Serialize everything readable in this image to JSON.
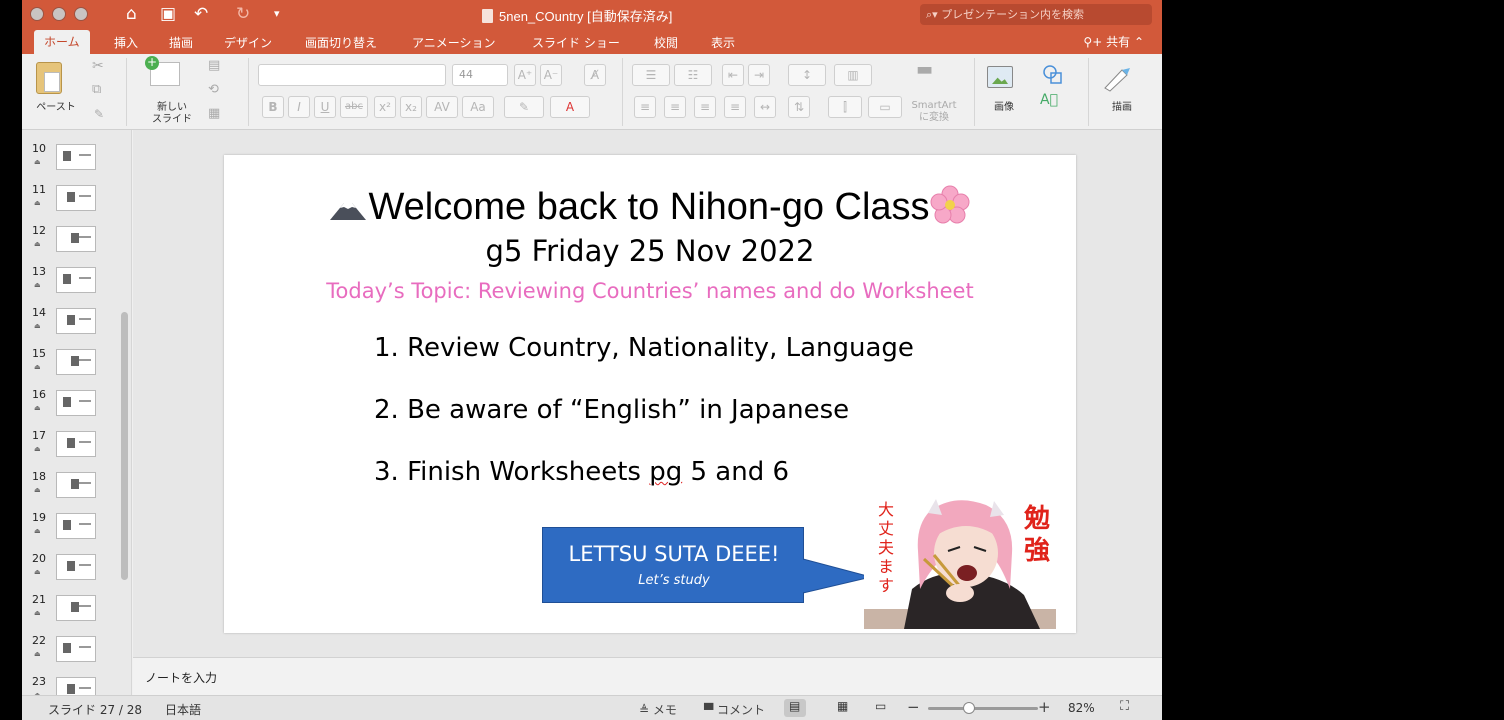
{
  "window": {
    "title": "5nen_COuntry [自動保存済み]",
    "search_placeholder": "プレゼンテーション内を検索",
    "share_label": "共有"
  },
  "tabs": [
    "ホーム",
    "挿入",
    "描画",
    "デザイン",
    "画面切り替え",
    "アニメーション",
    "スライド ショー",
    "校閲",
    "表示"
  ],
  "active_tab": "ホーム",
  "ribbon": {
    "paste_label": "ペースト",
    "new_slide_label": "新しい\nスライド",
    "font_size": "44",
    "smartart_label": "SmartArt\nに変換",
    "image_label": "画像",
    "draw_label": "描画"
  },
  "thumbnails": [
    "10",
    "11",
    "12",
    "13",
    "14",
    "15",
    "16",
    "17",
    "18",
    "19",
    "20",
    "21",
    "22",
    "23"
  ],
  "slide": {
    "title": "Welcome back to Nihon-go Class",
    "subtitle": "g5 Friday 25 Nov 2022",
    "topic": "Today’s Topic: Reviewing Countries’ names and do Worksheet",
    "item1": "1. Review Country, Nationality, Language",
    "item2": "2. Be aware of “English” in Japanese",
    "item3_pre": "3. Finish Worksheets ",
    "item3_pg": "pg",
    "item3_post": " 5 and 6",
    "callout_main": "LETTSU SUTA DEEE!",
    "callout_sub": "Let’s study",
    "sticker_left": "大丈夫ます",
    "sticker_right": "勉強"
  },
  "notes_placeholder": "ノートを入力",
  "status": {
    "slide_counter": "スライド 27 / 28",
    "language": "日本語",
    "memo": "メモ",
    "comment": "コメント",
    "zoom": "82%"
  },
  "colors": {
    "titlebar": "#d2593a",
    "topic_pink": "#e86cbf",
    "callout_blue": "#2e6bc2",
    "sticker_red": "#e0231b"
  }
}
